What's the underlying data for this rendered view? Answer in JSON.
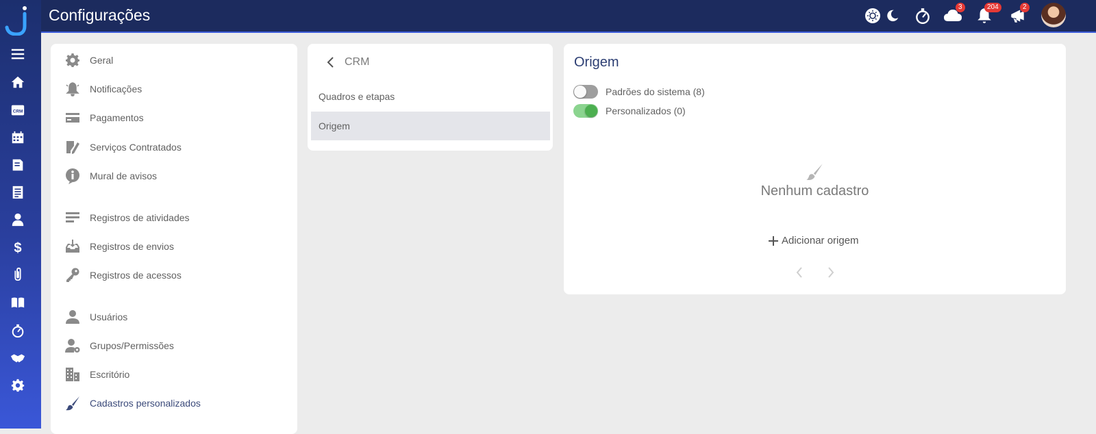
{
  "app": {
    "title": "Configurações"
  },
  "rail": {
    "items": [
      "menu-icon",
      "home-icon",
      "crm-icon",
      "calendar-icon",
      "document-icon",
      "list-document-icon",
      "user-icon",
      "dollar-icon",
      "paperclip-icon",
      "book-icon",
      "stopwatch-icon",
      "handshake-icon",
      "gear-icon"
    ],
    "crm_badge": "CRM"
  },
  "topbar": {
    "icons": [
      {
        "name": "light-theme-icon"
      },
      {
        "name": "dark-theme-icon"
      },
      {
        "name": "stopwatch-icon"
      },
      {
        "name": "cloud-icon",
        "badge": "3"
      },
      {
        "name": "bell-icon",
        "badge": "204"
      },
      {
        "name": "megaphone-icon",
        "badge": "2"
      }
    ]
  },
  "settings_menu": {
    "group1": [
      {
        "label": "Geral",
        "icon": "gear-icon"
      },
      {
        "label": "Notificações",
        "icon": "bell-icon"
      },
      {
        "label": "Pagamentos",
        "icon": "credit-card-icon"
      },
      {
        "label": "Serviços Contratados",
        "icon": "document-edit-icon"
      },
      {
        "label": "Mural de avisos",
        "icon": "info-icon"
      }
    ],
    "group2": [
      {
        "label": "Registros de atividades",
        "icon": "lines-icon"
      },
      {
        "label": "Registros de envios",
        "icon": "inbox-download-icon"
      },
      {
        "label": "Registros de acessos",
        "icon": "key-icon"
      }
    ],
    "group3": [
      {
        "label": "Usuários",
        "icon": "user-icon"
      },
      {
        "label": "Grupos/Permissões",
        "icon": "user-gear-icon"
      },
      {
        "label": "Escritório",
        "icon": "building-icon"
      },
      {
        "label": "Cadastros personalizados",
        "icon": "brush-icon",
        "active": true
      }
    ]
  },
  "crm_panel": {
    "title": "CRM",
    "items": [
      {
        "label": "Quadros e etapas",
        "selected": false
      },
      {
        "label": "Origem",
        "selected": true
      }
    ]
  },
  "origem_panel": {
    "title": "Origem",
    "toggles": [
      {
        "label": "Padrões do sistema (8)",
        "on": false
      },
      {
        "label": "Personalizados (0)",
        "on": true
      }
    ],
    "empty_text": "Nenhum cadastro",
    "add_label": "Adicionar origem"
  },
  "colors": {
    "topbar": "#1c2b5e",
    "accent": "#3b5bd8",
    "toggle_on": "#4caf50",
    "toggle_on_track": "#8bd48f",
    "badge": "#e53935"
  }
}
